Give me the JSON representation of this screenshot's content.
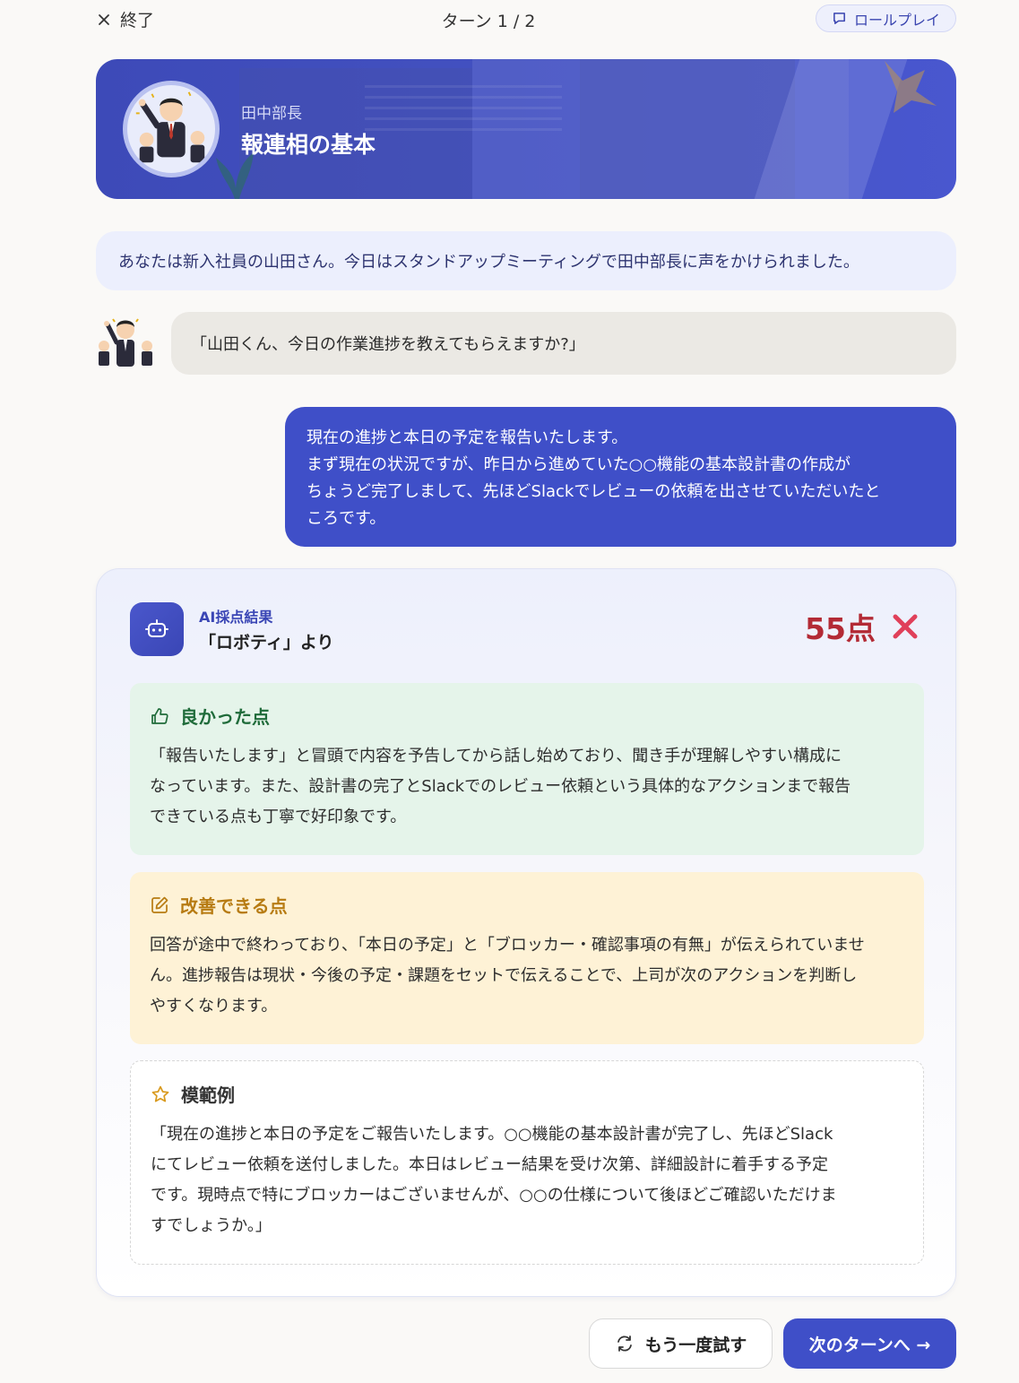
{
  "topbar": {
    "exit_label": "終了",
    "turn_label": "ターン 1 / 2",
    "mode_badge": "ロールプレイ"
  },
  "header": {
    "character_name": "田中部長",
    "lesson_title": "報連相の基本"
  },
  "scenario": {
    "text": "あなたは新入社員の山田さん。今日はスタンドアップミーティングで田中部長に声をかけられました。"
  },
  "conversation": {
    "boss_message": "「山田くん、今日の作業進捗を教えてもらえますか?」",
    "user_message_lines": [
      "現在の進捗と本日の予定を報告いたします。",
      "まず現在の状況ですが、昨日から進めていた○○機能の基本設計書の作成が",
      "ちょうど完了しまして、先ほどSlackでレビューの依頼を出させていただいたと",
      "ころです。"
    ]
  },
  "feedback": {
    "label": "AI採点結果",
    "from": "「ロボティ」より",
    "score": "55点",
    "colors": {
      "score": "#b32a35",
      "fail_icon": "#e0405a",
      "accent": "#3f4fc8"
    },
    "good": {
      "title": "良かった点",
      "lines": [
        "「報告いたします」と冒頭で内容を予告してから話し始めており、聞き手が理解しやすい構成に",
        "なっています。また、設計書の完了とSlackでのレビュー依頼という具体的なアクションまで報告",
        "できている点も丁寧で好印象です。"
      ]
    },
    "improve": {
      "title": "改善できる点",
      "lines": [
        "回答が途中で終わっており、「本日の予定」と「ブロッカー・確認事項の有無」が伝えられていませ",
        "ん。進捗報告は現状・今後の予定・課題をセットで伝えることで、上司が次のアクションを判断し",
        "やすくなります。"
      ]
    },
    "model": {
      "title": "模範例",
      "lines": [
        "「現在の進捗と本日の予定をご報告いたします。○○機能の基本設計書が完了し、先ほどSlack",
        "にてレビュー依頼を送付しました。本日はレビュー結果を受け次第、詳細設計に着手する予定",
        "です。現時点で特にブロッカーはございませんが、○○の仕様について後ほどご確認いただけま",
        "すでしょうか。」"
      ]
    }
  },
  "actions": {
    "retry_label": "もう一度試す",
    "next_label": "次のターンへ →"
  }
}
